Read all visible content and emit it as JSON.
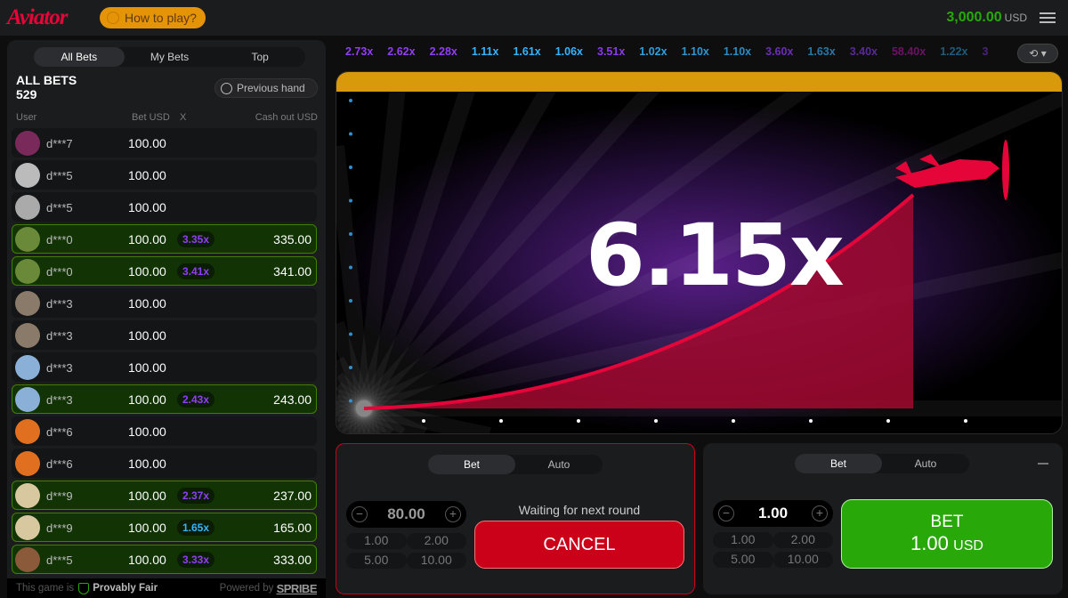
{
  "header": {
    "logo": "Aviator",
    "how_to_play": "How to play?",
    "balance": "3,000.00",
    "currency": "USD"
  },
  "bets_panel": {
    "tabs": [
      "All Bets",
      "My Bets",
      "Top"
    ],
    "title": "ALL BETS",
    "count": "529",
    "previous_hand": "Previous hand",
    "columns": {
      "user": "User",
      "bet": "Bet USD",
      "x": "X",
      "cashout": "Cash out USD"
    },
    "rows": [
      {
        "user": "d***7",
        "bet": "100.00",
        "mult": "",
        "cashout": "",
        "win": false,
        "avatar": "#7a2a5a"
      },
      {
        "user": "d***5",
        "bet": "100.00",
        "mult": "",
        "cashout": "",
        "win": false,
        "avatar": "#bbb"
      },
      {
        "user": "d***5",
        "bet": "100.00",
        "mult": "",
        "cashout": "",
        "win": false,
        "avatar": "#aaa"
      },
      {
        "user": "d***0",
        "bet": "100.00",
        "mult": "3.35x",
        "cashout": "335.00",
        "win": true,
        "avatar": "#6a8a3a"
      },
      {
        "user": "d***0",
        "bet": "100.00",
        "mult": "3.41x",
        "cashout": "341.00",
        "win": true,
        "avatar": "#6a8a3a"
      },
      {
        "user": "d***3",
        "bet": "100.00",
        "mult": "",
        "cashout": "",
        "win": false,
        "avatar": "#8a7a6a"
      },
      {
        "user": "d***3",
        "bet": "100.00",
        "mult": "",
        "cashout": "",
        "win": false,
        "avatar": "#8a7a6a"
      },
      {
        "user": "d***3",
        "bet": "100.00",
        "mult": "",
        "cashout": "",
        "win": false,
        "avatar": "#8ab0d8"
      },
      {
        "user": "d***3",
        "bet": "100.00",
        "mult": "2.43x",
        "cashout": "243.00",
        "win": true,
        "avatar": "#8ab0d8"
      },
      {
        "user": "d***6",
        "bet": "100.00",
        "mult": "",
        "cashout": "",
        "win": false,
        "avatar": "#e07020"
      },
      {
        "user": "d***6",
        "bet": "100.00",
        "mult": "",
        "cashout": "",
        "win": false,
        "avatar": "#e07020"
      },
      {
        "user": "d***9",
        "bet": "100.00",
        "mult": "2.37x",
        "cashout": "237.00",
        "win": true,
        "avatar": "#d8c8a0"
      },
      {
        "user": "d***9",
        "bet": "100.00",
        "mult": "1.65x",
        "cashout": "165.00",
        "win": true,
        "avatar": "#d8c8a0"
      },
      {
        "user": "d***5",
        "bet": "100.00",
        "mult": "3.33x",
        "cashout": "333.00",
        "win": true,
        "avatar": "#8a5a3a"
      }
    ],
    "footer": {
      "text": "This game is",
      "fair": "Provably Fair",
      "powered": "Powered by",
      "brand": "SPRIBE"
    }
  },
  "history": [
    "2.73x",
    "2.62x",
    "2.28x",
    "1.11x",
    "1.61x",
    "1.06x",
    "3.51x",
    "1.02x",
    "1.10x",
    "1.10x",
    "3.60x",
    "1.63x",
    "3.40x",
    "58.40x",
    "1.22x",
    "3"
  ],
  "colors": {
    "blue": "#34b4ff",
    "purple": "#913ef8",
    "pink": "#c017b4",
    "green": "#28a909",
    "red": "#cb011a"
  },
  "game": {
    "multiplier": "6.15x"
  },
  "bet_panels": [
    {
      "tabs": [
        "Bet",
        "Auto"
      ],
      "amount": "80.00",
      "quick": [
        "1.00",
        "2.00",
        "5.00",
        "10.00"
      ],
      "waiting": "Waiting for next round",
      "button": "CANCEL"
    },
    {
      "tabs": [
        "Bet",
        "Auto"
      ],
      "amount": "1.00",
      "quick": [
        "1.00",
        "2.00",
        "5.00",
        "10.00"
      ],
      "button": "BET",
      "button_amount": "1.00",
      "currency": "USD"
    }
  ]
}
